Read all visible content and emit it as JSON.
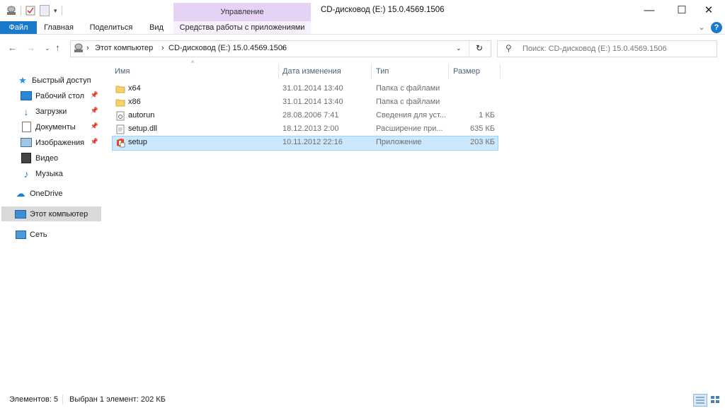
{
  "window": {
    "title": "CD-дисковод (E:) 15.0.4569.1506",
    "context_group": "Управление",
    "controls": {
      "minimize": "—",
      "maximize": "☐",
      "close": "✕"
    }
  },
  "ribbon": {
    "tabs": [
      "Файл",
      "Главная",
      "Поделиться",
      "Вид",
      "Средства работы с приложениями"
    ],
    "help": "?",
    "expand": "⌄"
  },
  "address": {
    "crumbs": [
      "Этот компьютер",
      "CD-дисковод (E:) 15.0.4569.1506"
    ],
    "search_placeholder": "Поиск: CD-дисковод (E:) 15.0.4569.1506"
  },
  "nav": {
    "quick_access": "Быстрый доступ",
    "items": [
      {
        "label": "Рабочий стол",
        "icon": "desktop-icon",
        "pinned": true
      },
      {
        "label": "Загрузки",
        "icon": "downloads-icon",
        "pinned": true
      },
      {
        "label": "Документы",
        "icon": "documents-icon",
        "pinned": true
      },
      {
        "label": "Изображения",
        "icon": "pictures-icon",
        "pinned": true
      },
      {
        "label": "Видео",
        "icon": "video-icon",
        "pinned": false
      },
      {
        "label": "Музыка",
        "icon": "music-icon",
        "pinned": false
      }
    ],
    "onedrive": "OneDrive",
    "this_pc": "Этот компьютер",
    "network": "Сеть"
  },
  "columns": [
    "Имя",
    "Дата изменения",
    "Тип",
    "Размер"
  ],
  "files": [
    {
      "name": "x64",
      "date": "31.01.2014 13:40",
      "type": "Папка с файлами",
      "size": "",
      "icon": "folder-icon"
    },
    {
      "name": "x86",
      "date": "31.01.2014 13:40",
      "type": "Папка с файлами",
      "size": "",
      "icon": "folder-icon"
    },
    {
      "name": "autorun",
      "date": "28.08.2006 7:41",
      "type": "Сведения для уст...",
      "size": "1 КБ",
      "icon": "settings-file-icon"
    },
    {
      "name": "setup.dll",
      "date": "18.12.2013 2:00",
      "type": "Расширение при...",
      "size": "635 КБ",
      "icon": "dll-file-icon"
    },
    {
      "name": "setup",
      "date": "10.11.2012 22:16",
      "type": "Приложение",
      "size": "203 КБ",
      "icon": "office-setup-icon"
    }
  ],
  "status": {
    "count": "Элементов: 5",
    "selection": "Выбран 1 элемент: 202 КБ"
  },
  "colors": {
    "file_tab": "#1979ca",
    "context_tab": "#e5d2f5",
    "selection": "#cce8ff"
  }
}
